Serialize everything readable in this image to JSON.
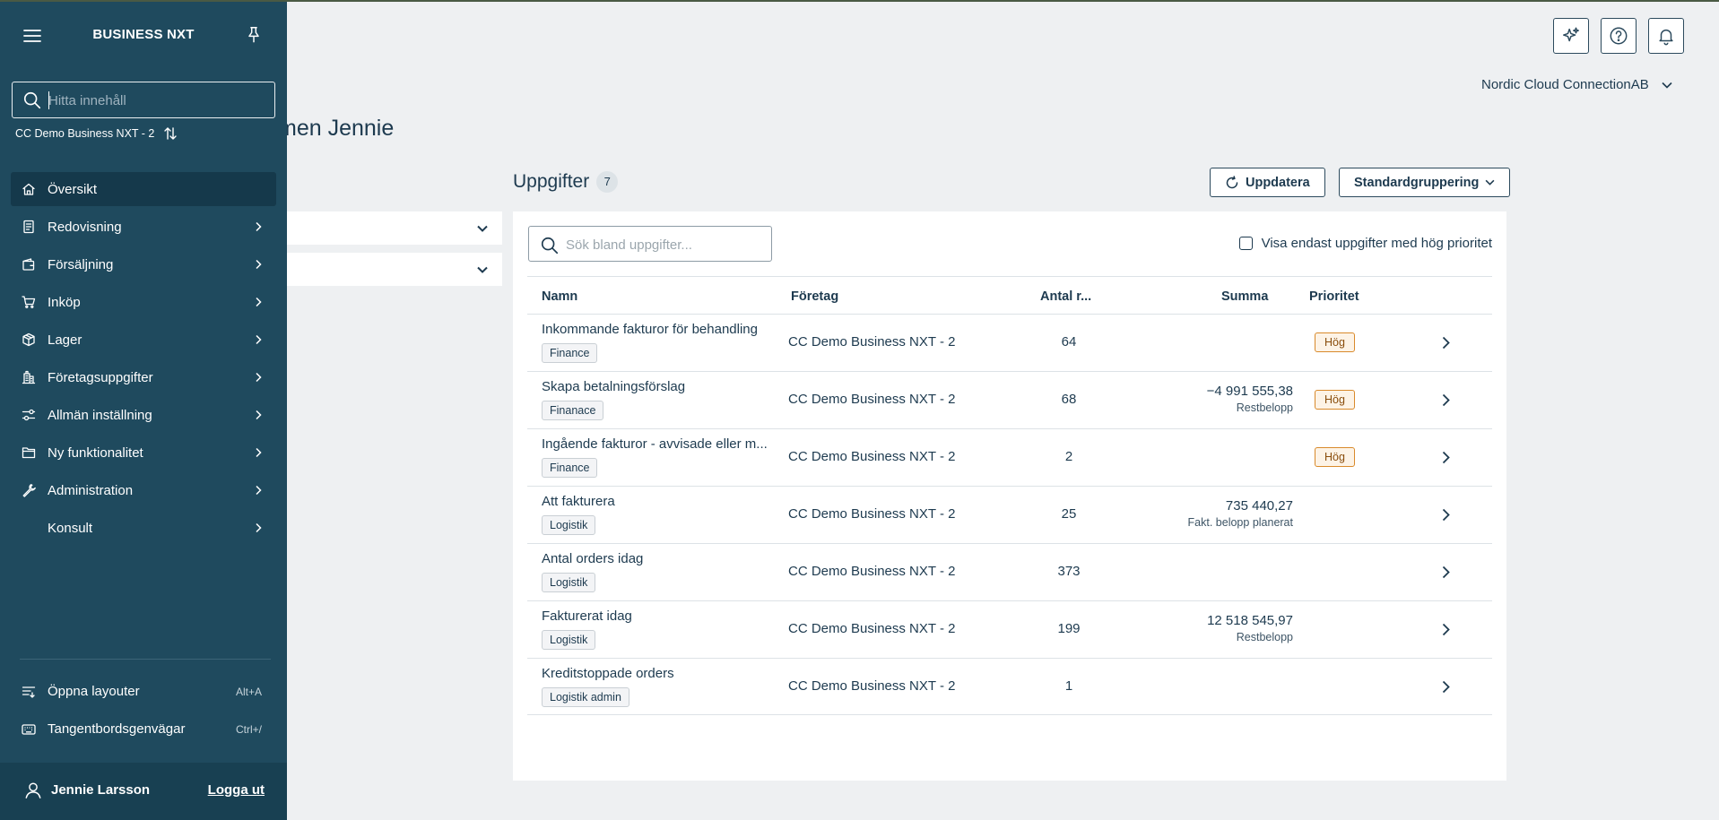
{
  "sidebar": {
    "brand": "BUSINESS NXT",
    "search_placeholder": "Hitta innehåll",
    "company": "CC Demo Business NXT - 2",
    "items": [
      {
        "label": "Översikt",
        "icon": "home-icon",
        "active": true,
        "has_children": false
      },
      {
        "label": "Redovisning",
        "icon": "ledger-icon",
        "active": false,
        "has_children": true
      },
      {
        "label": "Försäljning",
        "icon": "wallet-icon",
        "active": false,
        "has_children": true
      },
      {
        "label": "Inköp",
        "icon": "cart-icon",
        "active": false,
        "has_children": true
      },
      {
        "label": "Lager",
        "icon": "box-icon",
        "active": false,
        "has_children": true
      },
      {
        "label": "Företagsuppgifter",
        "icon": "building-icon",
        "active": false,
        "has_children": true
      },
      {
        "label": "Allmän inställning",
        "icon": "settings-sliders-icon",
        "active": false,
        "has_children": true
      },
      {
        "label": "Ny funktionalitet",
        "icon": "folder-icon",
        "active": false,
        "has_children": true
      },
      {
        "label": "Administration",
        "icon": "wrench-icon",
        "active": false,
        "has_children": true
      },
      {
        "label": "Konsult",
        "icon": "",
        "active": false,
        "has_children": true
      }
    ],
    "utilities": [
      {
        "label": "Öppna layouter",
        "shortcut": "Alt+A",
        "icon": "layouts-icon"
      },
      {
        "label": "Tangentbordsgenvägar",
        "shortcut": "Ctrl+/",
        "icon": "keyboard-icon"
      }
    ],
    "user": {
      "name": "Jennie Larsson",
      "logout": "Logga ut"
    }
  },
  "header": {
    "org": "Nordic Cloud ConnectionAB",
    "welcome": "men Jennie"
  },
  "tasks": {
    "title": "Uppgifter",
    "count": "7",
    "refresh_label": "Uppdatera",
    "grouping_label": "Standardgruppering",
    "search_placeholder": "Sök bland uppgifter...",
    "high_priority_label": "Visa endast uppgifter med hög prioritet",
    "columns": {
      "name": "Namn",
      "company": "Företag",
      "count": "Antal r...",
      "sum": "Summa",
      "priority": "Prioritet"
    },
    "rows": [
      {
        "name": "Inkommande fakturor för behandling",
        "tag": "Finance",
        "company": "CC Demo Business NXT - 2",
        "count": "64",
        "sum": "",
        "sum_label": "",
        "priority": "Hög"
      },
      {
        "name": "Skapa betalningsförslag",
        "tag": "Finanace",
        "company": "CC Demo Business NXT - 2",
        "count": "68",
        "sum": "−4 991 555,38",
        "sum_label": "Restbelopp",
        "priority": "Hög"
      },
      {
        "name": "Ingående fakturor - avvisade eller m...",
        "tag": "Finance",
        "company": "CC Demo Business NXT - 2",
        "count": "2",
        "sum": "",
        "sum_label": "",
        "priority": "Hög"
      },
      {
        "name": "Att fakturera",
        "tag": "Logistik",
        "company": "CC Demo Business NXT - 2",
        "count": "25",
        "sum": "735 440,27",
        "sum_label": "Fakt. belopp planerat",
        "priority": ""
      },
      {
        "name": "Antal orders idag",
        "tag": "Logistik",
        "company": "CC Demo Business NXT - 2",
        "count": "373",
        "sum": "",
        "sum_label": "",
        "priority": ""
      },
      {
        "name": "Fakturerat idag",
        "tag": "Logistik",
        "company": "CC Demo Business NXT - 2",
        "count": "199",
        "sum": "12 518 545,97",
        "sum_label": "Restbelopp",
        "priority": ""
      },
      {
        "name": "Kreditstoppade orders",
        "tag": "Logistik admin",
        "company": "CC Demo Business NXT - 2",
        "count": "1",
        "sum": "",
        "sum_label": "",
        "priority": ""
      }
    ]
  },
  "colors": {
    "sidebar_bg": "#1f4a5e",
    "sidebar_active": "#15394b",
    "accent_text": "#1d3a4f",
    "priority_border": "#d98a2b",
    "page_bg": "#eef0f2"
  }
}
